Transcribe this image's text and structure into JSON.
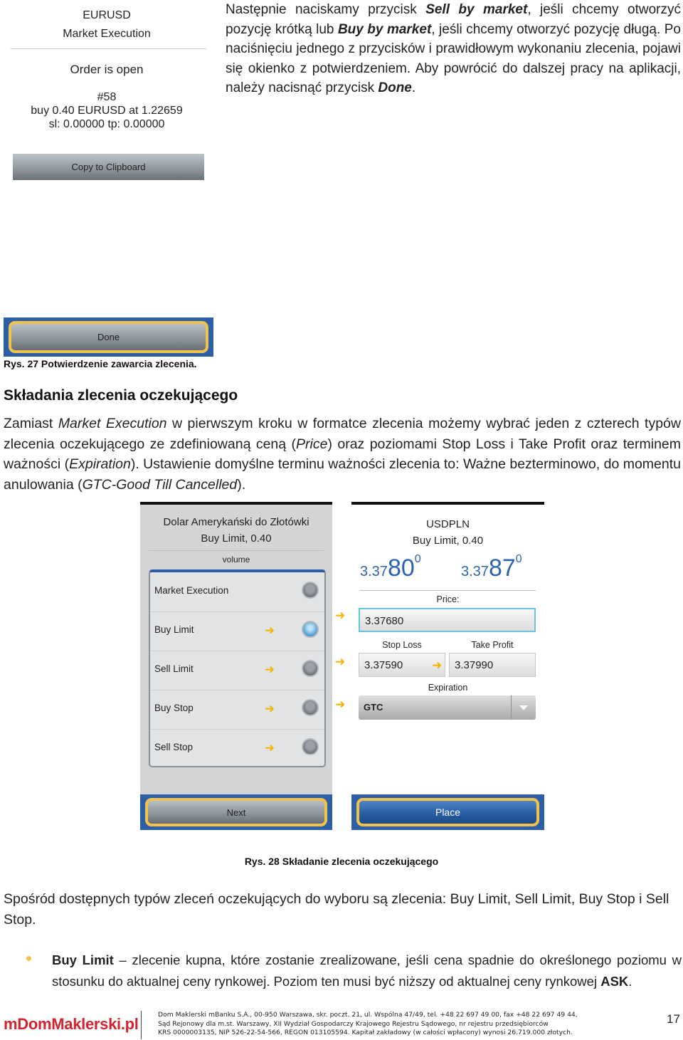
{
  "fig27": {
    "dialog": {
      "symbol": "EURUSD",
      "execution": "Market Execution",
      "status": "Order is open",
      "order_id": "#58",
      "order_line": "buy 0.40 EURUSD at 1.22659",
      "sl_tp_line": "sl: 0.00000 tp: 0.00000",
      "copy_button": "Copy to Clipboard",
      "done_button": "Done"
    },
    "caption": "Rys. 27 Potwierdzenie zawarcia zlecenia."
  },
  "intro_paragraph": {
    "t1": "Następnie naciskamy przycisk ",
    "b1": "Sell by market",
    "t2": ", jeśli chcemy otworzyć pozycję krótką lub ",
    "b2": "Buy by market",
    "t3": ", jeśli chcemy otworzyć pozycję długą. Po naciśnięciu jednego z przycisków i prawidłowym wykonaniu zlecenia, pojawi się okienko z potwierdzeniem. Aby powrócić do dalszej pracy na aplikacji, należy nacisnąć przycisk ",
    "b3": "Done",
    "t4": "."
  },
  "section": {
    "heading": "Składania zlecenia oczekującego",
    "p_t1": "Zamiast ",
    "p_i1": "Market Execution",
    "p_t2": " w pierwszym kroku w formatce zlecenia możemy wybrać jeden z czterech typów zlecenia oczekującego ze zdefiniowaną ceną (",
    "p_i2": "Price",
    "p_t3": ") oraz poziomami Stop Loss i Take Profit oraz terminem ważności (",
    "p_i3": "Expiration",
    "p_t4": "). Ustawienie domyślne terminu ważności zlecenia to: Ważne bezterminowo, do momentu anulowania (",
    "p_i4": "GTC-Good Till Cancelled",
    "p_t5": ")."
  },
  "fig28": {
    "left": {
      "title": "Dolar Amerykański do Złotówki",
      "subtitle": "Buy Limit, 0.40",
      "volume_label": "volume",
      "options": [
        {
          "label": "Market Execution",
          "selected": false
        },
        {
          "label": "Buy Limit",
          "selected": true
        },
        {
          "label": "Sell Limit",
          "selected": false
        },
        {
          "label": "Buy Stop",
          "selected": false
        },
        {
          "label": "Sell Stop",
          "selected": false
        }
      ],
      "next_button": "Next"
    },
    "right": {
      "symbol": "USDPLN",
      "subtitle": "Buy Limit, 0.40",
      "bid": {
        "prefix": "3.37",
        "big": "80",
        "sup": "0"
      },
      "ask": {
        "prefix": "3.37",
        "big": "87",
        "sup": "0"
      },
      "price_label": "Price:",
      "price_value": "3.37680",
      "stop_loss_label": "Stop Loss",
      "stop_loss_value": "3.37590",
      "take_profit_label": "Take Profit",
      "take_profit_value": "3.37990",
      "expiration_label": "Expiration",
      "expiration_value": "GTC",
      "place_button": "Place"
    },
    "caption": "Rys. 28 Składanie zlecenia oczekującego"
  },
  "types_paragraph": "Spośród dostępnych typów zleceń oczekujących do wyboru są zlecenia: Buy Limit, Sell Limit, Buy Stop i Sell Stop.",
  "bullet": {
    "term": "Buy Limit",
    "text": " – zlecenie kupna, które zostanie zrealizowane, jeśli cena spadnie do określonego poziomu w stosunku do aktualnej ceny rynkowej. Poziom ten musi być niższy od aktualnej ceny rynkowej ",
    "term2": "ASK",
    "end": "."
  },
  "footer": {
    "logo": "mDomMaklerski.pl",
    "line1": "Dom Maklerski mBanku S.A., 00-950 Warszawa, skr. poczt. 21, ul. Wspólna 47/49, tel. +48 22 697 49 00, fax +48 22 697 49 44,",
    "line2": "Sąd Rejonowy dla m.st. Warszawy, XII Wydział Gospodarczy Krajowego Rejestru Sądowego, nr rejestru przedsiębiorców",
    "line3": "KRS 0000003135, NIP 526-22-54-566, REGON 013105594. Kapitał zakładowy (w całości wpłacony) wynosi 26.719.000 złotych.",
    "page_number": "17"
  },
  "colors": {
    "accent_blue": "#2d5fa8",
    "highlight_gold": "#f0c24a",
    "logo_red": "#d4232e",
    "price_blue": "#2d64b0"
  }
}
